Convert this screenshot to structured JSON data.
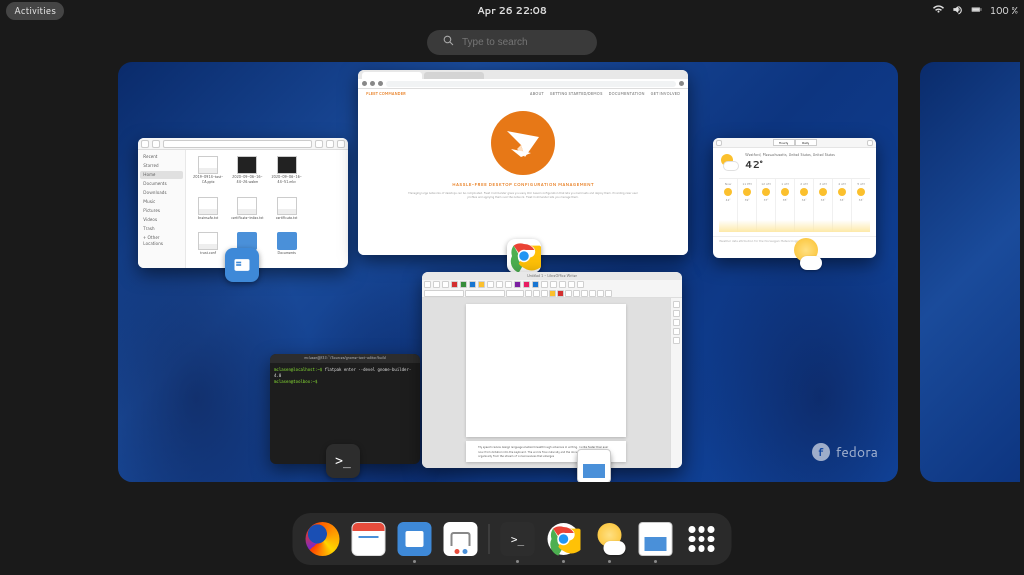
{
  "topbar": {
    "activities": "Activities",
    "clock": "Apr 26  22:08",
    "battery": "100 %"
  },
  "search": {
    "placeholder": "Type to search"
  },
  "brand": {
    "name": "fedora"
  },
  "files_window": {
    "sidebar": {
      "s0": "Recent",
      "s1": "Starred",
      "s2": "Home",
      "s3": "Documents",
      "s4": "Downloads",
      "s5": "Music",
      "s6": "Pictures",
      "s7": "Videos",
      "s8": "Trash",
      "s9": "+ Other Locations"
    },
    "items": {
      "i0": "2019-0914-test-CA.pptx",
      "i1": "2020-09-06-16-44-26.webm",
      "i2": "2020-09-06-16-44-51.mkv",
      "i3": "brainsafe.txt",
      "i4": "certificate-index.txt",
      "i5": "certificate.txt",
      "i6": "trust.conf",
      "i7": "testing",
      "i8": "Documents"
    }
  },
  "chrome_window": {
    "site_title": "FLEET COMMANDER",
    "nav": {
      "n0": "ABOUT",
      "n1": "GETTING STARTED/DEMOS",
      "n2": "DOCUMENTATION",
      "n3": "GET INVOLVED"
    },
    "headline": "HASSLE-FREE DESKTOP CONFIGURATION MANAGEMENT",
    "para": "Managing large networks of desktops can be complicated. Fleet Commander gives you easy GUI based configuration that lets you build sets and deploy them. Providing clear user profiles and applying them over the network. Fleet Commander lets you manage them."
  },
  "weather_window": {
    "tabs": {
      "t0": "Hourly",
      "t1": "Daily"
    },
    "location": "Westford, Massachusetts, United States, United States",
    "temperature": "42°",
    "condition": "Sunny",
    "hours": {
      "h0": {
        "time": "Now",
        "temp": "42°"
      },
      "h1": {
        "time": "11 PM",
        "temp": "39°"
      },
      "h2": {
        "time": "12 AM",
        "temp": "37°"
      },
      "h3": {
        "time": "1 AM",
        "temp": "35°"
      },
      "h4": {
        "time": "2 AM",
        "temp": "34°"
      },
      "h5": {
        "time": "3 AM",
        "temp": "33°"
      },
      "h6": {
        "time": "4 AM",
        "temp": "33°"
      },
      "h7": {
        "time": "5 AM",
        "temp": "33°"
      }
    },
    "footer": "Weather data attribution for the Norwegian Meteorological Institute"
  },
  "terminal_window": {
    "title": "mclasen@f33:~/Sources/gnome-text-editor/build",
    "lines": {
      "l0_prompt": "mclasen@localhost:~$",
      "l0_cmd": " flatpak enter --devel gnome-builder-4.0",
      "l1_prompt": "mclasen@toolbox:~$",
      "l1_cmd": " "
    }
  },
  "writer_window": {
    "title": "Untitled 1 - LibreOffice Writer",
    "page2_text": "My speech review design language enabled breakthrough advances in writing. I write faster than ever now from dictation into the keyboard. The words flow naturally and the document forms itself almost organically from the stream of consciousness that emerges"
  },
  "dock": {
    "items": {
      "d0": "Firefox",
      "d1": "Calendar",
      "d2": "Files",
      "d3": "Software",
      "d4": "Terminal",
      "d5": "Chrome",
      "d6": "Weather",
      "d7": "LibreOffice Writer",
      "d8": "Show Applications"
    }
  }
}
